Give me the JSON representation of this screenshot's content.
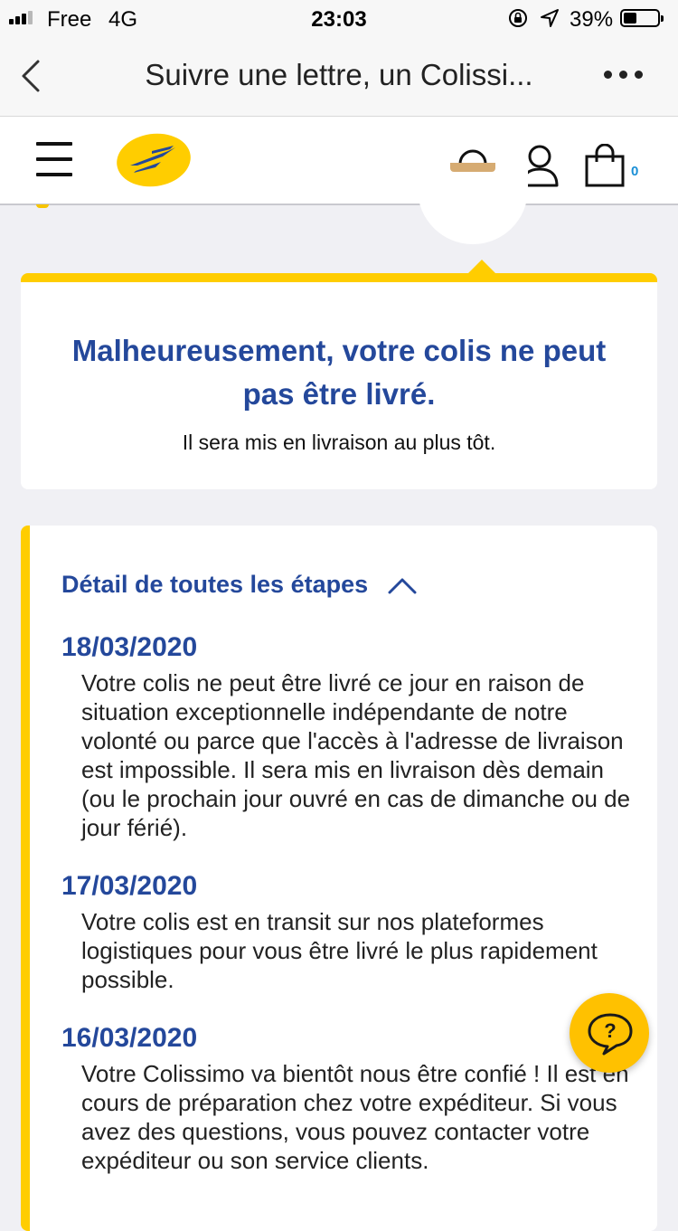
{
  "status_bar": {
    "carrier": "Free",
    "network": "4G",
    "time": "23:03",
    "battery_percent": "39%",
    "battery_level": 0.39
  },
  "nav": {
    "title": "Suivre une lettre, un Colissi...",
    "back_icon": "chevron-left-icon",
    "more_icon": "more-horizontal-icon"
  },
  "header": {
    "logo": "la-poste-logo",
    "cart_count": "0",
    "icons": [
      "menu-icon",
      "search-icon",
      "user-icon",
      "shopping-bag-icon"
    ]
  },
  "status_card": {
    "title": "Malheureusement, votre colis ne peut pas être livré.",
    "subtitle": "Il sera mis en livraison au plus tôt."
  },
  "steps": {
    "header": "Détail de toutes les étapes",
    "items": [
      {
        "date": "18/03/2020",
        "text": "Votre colis ne peut être livré ce jour en raison de situation exceptionnelle indépendante de notre volonté ou parce que l'accès à l'adresse de livraison est impossible. Il sera mis en livraison dès demain (ou le prochain jour ouvré en cas de dimanche ou de jour férié)."
      },
      {
        "date": "17/03/2020",
        "text": "Votre colis est en transit sur nos plateformes logistiques pour vous être livré le plus rapidement possible."
      },
      {
        "date": "16/03/2020",
        "text": "Votre Colissimo va bientôt nous être confié ! Il est en cours de préparation chez votre expéditeur. Si vous avez des questions, vous pouvez contacter votre expéditeur ou son service clients."
      }
    ]
  },
  "colors": {
    "brand_yellow": "#ffcd00",
    "brand_blue": "#24489b",
    "fab_yellow": "#ffc100"
  }
}
